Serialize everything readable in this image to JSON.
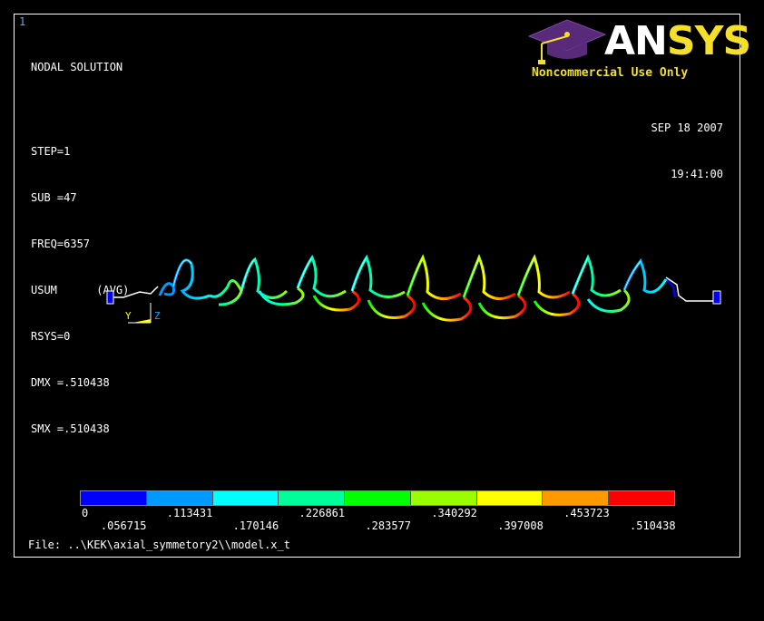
{
  "window_number": "1",
  "solution": {
    "title": "NODAL SOLUTION",
    "lines": [
      "STEP=1",
      "SUB =47",
      "FREQ=6357",
      "USUM      (AVG)",
      "RSYS=0",
      "DMX =.510438",
      "SMX =.510438"
    ]
  },
  "logo": {
    "brand_a": "AN",
    "brand_b": "SYS",
    "reg": "®",
    "notice": "Noncommercial Use Only"
  },
  "datetime": {
    "date": "SEP 18 2007",
    "time": "19:41:00"
  },
  "triad": {
    "y_label": "Y",
    "z_label": "Z"
  },
  "legend": {
    "colors": [
      "#0000ff",
      "#0099ff",
      "#00ffff",
      "#00ff99",
      "#00ff00",
      "#99ff00",
      "#ffff00",
      "#ff9900",
      "#ff0000"
    ],
    "top_labels": [
      "0",
      ".113431",
      ".226861",
      ".340292",
      ".453723"
    ],
    "bottom_labels": [
      ".056715",
      ".170146",
      ".283577",
      ".397008",
      ".510438"
    ]
  },
  "file_line": "File: ..\\KEK\\axial_symmetory2\\\\model.x_t"
}
